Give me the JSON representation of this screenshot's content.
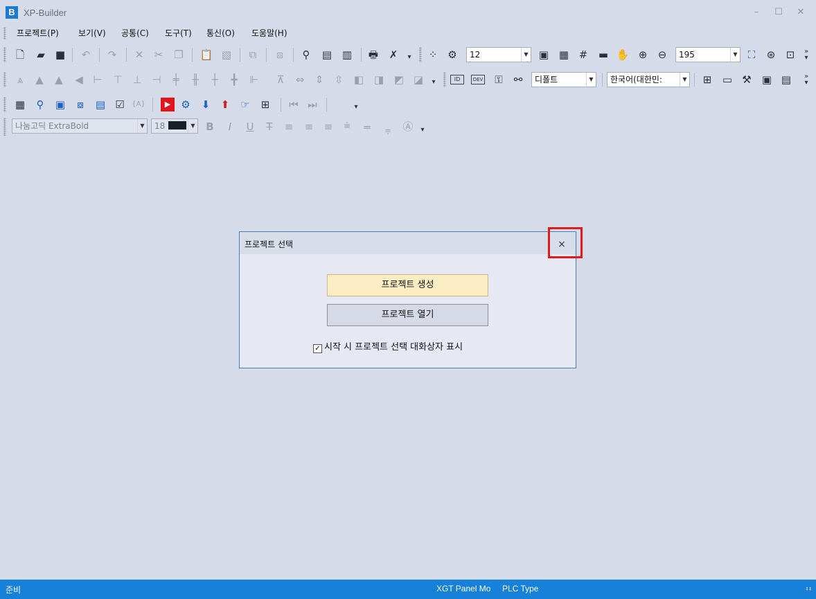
{
  "app": {
    "title": "XP-Builder",
    "icon_letter": "B",
    "window_controls": [
      "–",
      "☐",
      "✕"
    ]
  },
  "menu": [
    "프로젝트(P)",
    "보기(V)",
    "공통(C)",
    "도구(T)",
    "통신(O)",
    "도움말(H)"
  ],
  "toolbar": {
    "grid_size": "12",
    "zoom": "195",
    "style": "디폴트",
    "language": "한국어(대한민:",
    "font_name": "나눔고딕 ExtraBold",
    "font_size": "18",
    "tag_labels": [
      "ID",
      "DEV"
    ],
    "text_icon_label": "{A}"
  },
  "dialog": {
    "title": "프로젝트 선택",
    "close_glyph": "×",
    "create_button": "프로젝트 생성",
    "open_button": "프로젝트 열기",
    "show_on_start_label": "시작 시 프로젝트 선택 대화상자 표시",
    "show_on_start_checked": true
  },
  "status": {
    "state": "준비",
    "panel": "XGT Panel Mo",
    "plc": "PLC Type"
  },
  "colors": {
    "background": "#d6dbe9",
    "statusbar": "#1780d8",
    "primary_button": "#fdedc4",
    "highlight": "#e01b1b"
  }
}
